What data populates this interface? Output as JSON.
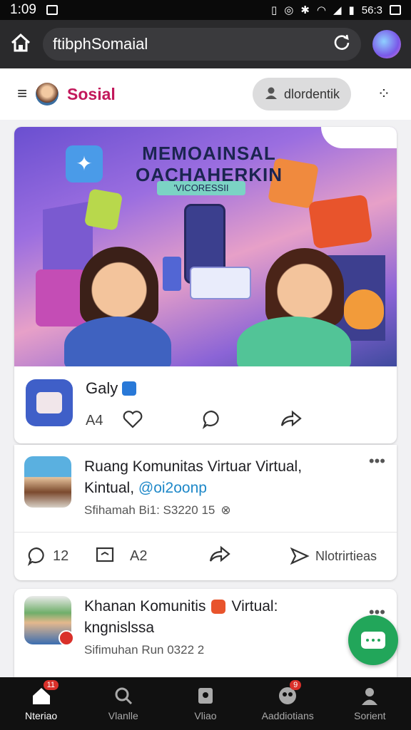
{
  "status_bar": {
    "time": "1:09",
    "clock_right": "56:3"
  },
  "browser": {
    "url": "ftibphSomaial"
  },
  "app_header": {
    "brand": "Sosial",
    "user_label": "dlordentik"
  },
  "hero": {
    "title_line1": "MEMOAINSAL",
    "title_line2": "OACHAHERKIN",
    "subtitle": "'VICORESSII"
  },
  "post1": {
    "author": "Galy",
    "reaction_count": "A4"
  },
  "post2": {
    "title_line1": "Ruang Komunitas Virtuar Virtual,",
    "title_line2_prefix": "Kintual,",
    "title_line2_tag": "@oi2oonp",
    "meta": "Sfihamah Bi1: S3220 15",
    "comments_count": "12",
    "share_count": "A2",
    "notify_label": "Nlotrirtieas"
  },
  "post3": {
    "title_line1": "Khanan Komunitis",
    "title_line1_suffix": "Virtual:",
    "title_line2": "kngnislssa",
    "meta": "Sifimuhan Run 0322 2"
  },
  "bottom_nav": {
    "items": [
      {
        "label": "Nteriao",
        "badge": "11"
      },
      {
        "label": "Vlanlle"
      },
      {
        "label": "Vliao"
      },
      {
        "label": "Aaddiotians",
        "badge": "9"
      },
      {
        "label": "Sorient"
      }
    ]
  },
  "colors": {
    "brand": "#c2185b",
    "fab": "#22a65a",
    "link": "#1e88c8"
  }
}
